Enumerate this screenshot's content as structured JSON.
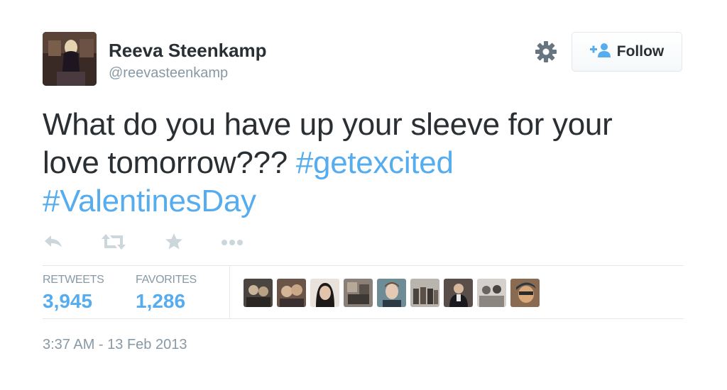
{
  "user": {
    "display_name": "Reeva Steenkamp",
    "handle": "@reevasteenkamp"
  },
  "follow_button": {
    "label": "Follow",
    "icon": "add-person-icon"
  },
  "settings_icon": "gear-icon",
  "tweet": {
    "text_line_1": "What do you have up your sleeve for your",
    "text_line_2": "love tomorrow??? ",
    "hashtags": [
      "#getexcited",
      "#ValentinesDay"
    ]
  },
  "actions": [
    {
      "name": "reply-icon"
    },
    {
      "name": "retweet-icon"
    },
    {
      "name": "favorite-star-icon"
    },
    {
      "name": "more-dots-icon"
    }
  ],
  "stats": {
    "retweets_label": "RETWEETS",
    "retweets_count": "3,945",
    "favorites_label": "FAVORITES",
    "favorites_count": "1,286"
  },
  "timestamp": "3:37 AM - 13 Feb 2013",
  "colors": {
    "accent": "#55acee",
    "text": "#292f33",
    "muted": "#8899a6",
    "border": "#e1e8ed"
  }
}
